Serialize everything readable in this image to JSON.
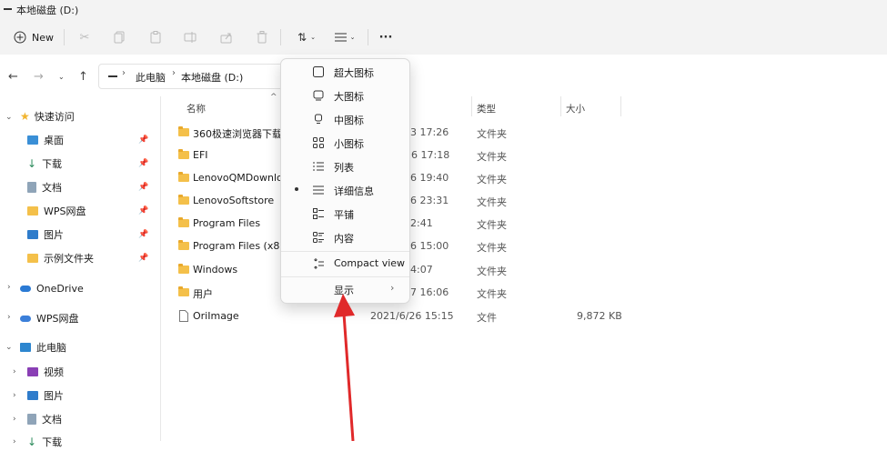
{
  "window": {
    "title": "本地磁盘 (D:)"
  },
  "toolbar": {
    "new_label": "New"
  },
  "breadcrumb": {
    "items": [
      "此电脑",
      "本地磁盘 (D:)"
    ]
  },
  "columns": {
    "name": "名称",
    "type": "类型",
    "size": "大小"
  },
  "sidebar": {
    "quick_access": "快速访问",
    "items": [
      {
        "label": "桌面"
      },
      {
        "label": "下载"
      },
      {
        "label": "文档"
      },
      {
        "label": "WPS网盘"
      },
      {
        "label": "图片"
      },
      {
        "label": "示例文件夹"
      }
    ],
    "onedrive": "OneDrive",
    "wps": "WPS网盘",
    "this_pc": "此电脑",
    "pc_items": [
      {
        "label": "视频"
      },
      {
        "label": "图片"
      },
      {
        "label": "文档"
      },
      {
        "label": "下载"
      }
    ]
  },
  "files": [
    {
      "name": "360极速浏览器下载",
      "date": "3 17:26",
      "type": "文件夹",
      "size": ""
    },
    {
      "name": "EFI",
      "date": "26 17:18",
      "type": "文件夹",
      "size": ""
    },
    {
      "name": "LenovoQMDownload",
      "date": "6 19:40",
      "type": "文件夹",
      "size": ""
    },
    {
      "name": "LenovoSoftstore",
      "date": "6 23:31",
      "type": "文件夹",
      "size": ""
    },
    {
      "name": "Program Files",
      "date": "2:41",
      "type": "文件夹",
      "size": ""
    },
    {
      "name": "Program Files (x86)",
      "date": "6 15:00",
      "type": "文件夹",
      "size": ""
    },
    {
      "name": "Windows",
      "date": "4:07",
      "type": "文件夹",
      "size": ""
    },
    {
      "name": "用户",
      "date": "7 16:06",
      "type": "文件夹",
      "size": ""
    },
    {
      "name": "OriImage",
      "date": "2021/6/26 15:15",
      "type": "文件",
      "size": "9,872 KB"
    }
  ],
  "view_menu": {
    "items": [
      {
        "label": "超大图标",
        "icon": "extra-large-icons-icon"
      },
      {
        "label": "大图标",
        "icon": "large-icons-icon"
      },
      {
        "label": "中图标",
        "icon": "medium-icons-icon"
      },
      {
        "label": "小图标",
        "icon": "small-icons-icon"
      },
      {
        "label": "列表",
        "icon": "list-icon"
      },
      {
        "label": "详细信息",
        "icon": "details-icon",
        "selected": true
      },
      {
        "label": "平铺",
        "icon": "tiles-icon"
      },
      {
        "label": "内容",
        "icon": "content-icon"
      }
    ],
    "compact": "Compact view",
    "show": "显示"
  },
  "colors": {
    "arrow": "#e0292a",
    "folder": "#f4c04a",
    "accent": "#0067c0"
  }
}
